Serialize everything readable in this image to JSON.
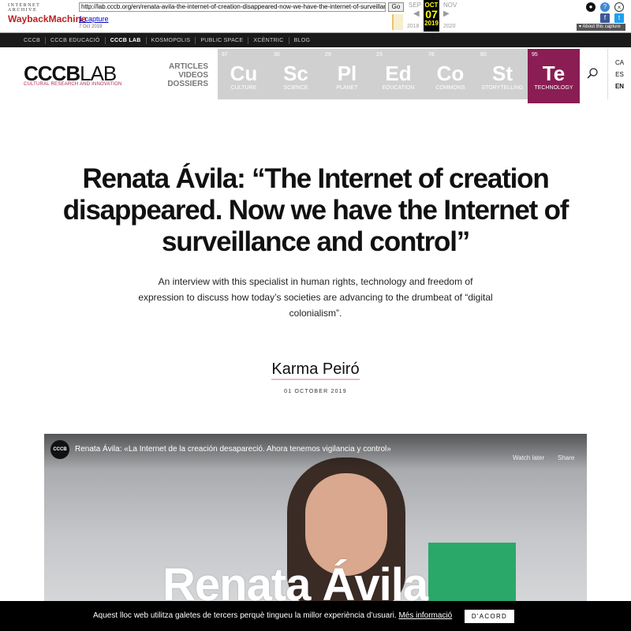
{
  "wayback": {
    "logo_top": "INTERNET ARCHIVE",
    "logo_main": "WaybackMachine",
    "url": "http://lab.cccb.org/en/renata-avila-the-internet-of-creation-disappeared-now-we-have-the-internet-of-surveillance-and-control/",
    "go_label": "Go",
    "captures_label": "1 capture",
    "capture_date": "7 Oct 2019",
    "prev_month": "SEP",
    "cur_month": "OCT",
    "next_month": "NOV",
    "cur_day": "07",
    "prev_year": "2018",
    "cur_year": "2019",
    "next_year": "2020",
    "about_label": "About this capture"
  },
  "topnav": {
    "items": [
      {
        "label": "CCCB"
      },
      {
        "label": "CCCB EDUCACIÓ"
      },
      {
        "label": "CCCB LAB"
      },
      {
        "label": "KOSMOPOLIS"
      },
      {
        "label": "PUBLIC SPACE"
      },
      {
        "label": "XCÈNTRIC"
      },
      {
        "label": "BLOG"
      }
    ],
    "active": "CCCB LAB"
  },
  "header": {
    "logo_bold": "CCCB",
    "logo_light": "LAB",
    "logo_subtitle": "CULTURAL RESEARCH AND INNOVATION",
    "sections": [
      "ARTICLES",
      "VIDEOS",
      "DOSSIERS"
    ],
    "tiles": [
      {
        "num": "97",
        "sym": "Cu",
        "name": "CULTURE"
      },
      {
        "num": "30",
        "sym": "Sc",
        "name": "SCIENCE"
      },
      {
        "num": "29",
        "sym": "Pl",
        "name": "PLANET"
      },
      {
        "num": "23",
        "sym": "Ed",
        "name": "EDUCATION"
      },
      {
        "num": "76",
        "sym": "Co",
        "name": "COMMONS"
      },
      {
        "num": "80",
        "sym": "St",
        "name": "STORYTELLING"
      },
      {
        "num": "95",
        "sym": "Te",
        "name": "TECHNOLOGY"
      }
    ],
    "active_tile": "Te",
    "languages": [
      "CA",
      "ES",
      "EN"
    ],
    "active_language": "EN",
    "tile_bg": "#d0d0d0",
    "accent": "#8a1d53"
  },
  "article": {
    "title": "Renata Ávila: “The Internet of creation disappeared. Now we have the Internet of surveillance and control”",
    "lead": "An interview with this specialist in human rights, technology and freedom of expression to discuss how today’s societies are advancing to the drumbeat of “digital colonialism”.",
    "author": "Karma Peiró",
    "date": "01 OCTOBER 2019"
  },
  "video": {
    "channel": "CCCB",
    "title": "Renata Ávila: «La Internet de la creación desapareció. Ahora tenemos vigilancia y control»",
    "watch_later": "Watch later",
    "share": "Share",
    "overlay_name": "Renata Ávila"
  },
  "cookie": {
    "text": "Aquest lloc web utilitza galetes de tercers perquè tingueu la millor experiència d’usuari.",
    "link": "Més informació",
    "button": "D'ACORD"
  }
}
